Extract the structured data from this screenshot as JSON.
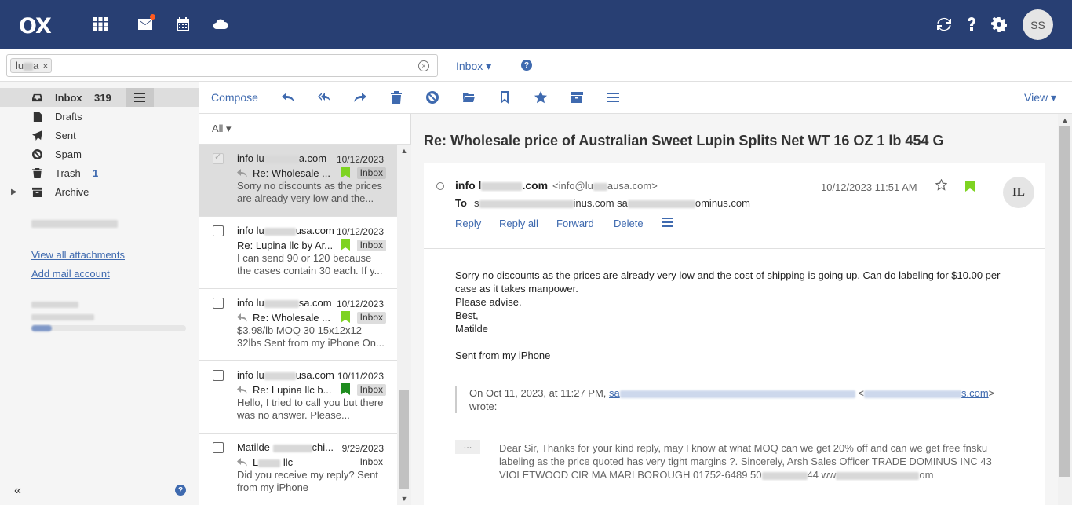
{
  "topbar": {
    "logo": "OX",
    "avatar_initials": "SS",
    "icons": [
      "apps-grid-icon",
      "mail-icon",
      "calendar-icon",
      "cloud-icon",
      "refresh-icon",
      "help-icon",
      "settings-icon"
    ],
    "bar_color": "#283f73"
  },
  "search": {
    "token_prefix": "lu",
    "token_suffix": "a",
    "token_remove": "×",
    "clear": "×",
    "folder_filter": "Inbox ▾",
    "help": "?"
  },
  "sidebar": {
    "folders": [
      {
        "label": "Inbox",
        "count": "319"
      },
      {
        "label": "Drafts",
        "count": ""
      },
      {
        "label": "Sent",
        "count": ""
      },
      {
        "label": "Spam",
        "count": ""
      },
      {
        "label": "Trash",
        "count": "1"
      },
      {
        "label": "Archive",
        "count": ""
      }
    ],
    "view_attachments": "View all attachments",
    "add_account": "Add mail account",
    "collapse": "«",
    "help": "?"
  },
  "toolbar": {
    "compose": "Compose",
    "view": "View ▾",
    "tools": [
      "reply-icon",
      "reply-all-icon",
      "forward-icon",
      "delete-icon",
      "spam-icon",
      "move-icon",
      "label-icon",
      "star-icon",
      "archive-icon",
      "more-icon"
    ]
  },
  "list": {
    "sort_label": "All ▾",
    "messages": [
      {
        "from_a": "info lu",
        "from_b": "a.com",
        "date": "10/12/2023",
        "subject": "Re: Wholesale ...",
        "folder": "Inbox",
        "preview": "Sorry no discounts as the prices are already very low and the...",
        "flag_color": "#7ed321",
        "replied": true
      },
      {
        "from_a": "info lu",
        "from_b": "usa.com",
        "date": "10/12/2023",
        "subject": "Re: Lupina llc by Ar...",
        "folder": "Inbox",
        "preview": "I can send 90 or 120 because the cases contain 30 each. If y...",
        "flag_color": "#7ed321",
        "replied": false
      },
      {
        "from_a": "info lu",
        "from_b": "sa.com",
        "date": "10/12/2023",
        "subject": "Re: Wholesale ...",
        "folder": "Inbox",
        "preview": "$3.98/lb MOQ 30 15x12x12 32lbs Sent from my iPhone On...",
        "flag_color": "#7ed321",
        "replied": true
      },
      {
        "from_a": "info lu",
        "from_b": "usa.com",
        "date": "10/11/2023",
        "subject": "Re: Lupina llc b...",
        "folder": "Inbox",
        "preview": "Hello, I tried to call you but there was no answer. Please...",
        "flag_color": "#1e8c1e",
        "replied": true
      },
      {
        "from_a": "Matilde",
        "from_b": "chi...",
        "date": "9/29/2023",
        "subject_a": "L",
        "subject_b": " llc",
        "folder": "Inbox",
        "preview": "Did you receive my reply? Sent from my iPhone",
        "flag_color": "",
        "replied": true
      }
    ]
  },
  "detail": {
    "title": "Re: Wholesale price of Australian Sweet Lupin Splits Net WT 16 OZ 1 lb 454 G",
    "sender_a": "info l",
    "sender_b": ".com",
    "addr_a": "<info@lu",
    "addr_b": "ausa.com>",
    "date": "10/12/2023 11:51 AM",
    "avatar": "IL",
    "to_label": "To",
    "to_a": "s",
    "to_b": "inus.com sa",
    "to_c": "ominus.com",
    "actions": {
      "reply": "Reply",
      "reply_all": "Reply all",
      "forward": "Forward",
      "delete": "Delete"
    },
    "body": [
      "Sorry no discounts as the prices are already very low and the cost of shipping is going up. Can do labeling for $10.00 per case as it takes manpower.",
      "Please advise.",
      "Best,",
      "Matilde",
      "",
      "Sent from my iPhone"
    ],
    "quote_intro": "On Oct 11, 2023, at 11:27 PM,",
    "quote_link_a": "sa",
    "quote_link_b": "s.com",
    "quote_wrote": "wrote:",
    "ellipsis": "...",
    "quoted_a": "Dear Sir, Thanks for your kind reply, may I know at what MOQ can we get 20% off and can we get free fnsku labeling as the price quoted has very tight margins ?. Sincerely, Arsh Sales Officer TRADE DOMINUS INC 43 VIOLETWOOD CIR MA MARLBOROUGH 01752-6489 50",
    "quoted_b": "44 ww",
    "quoted_c": "om",
    "flag_color": "#7ed321"
  }
}
